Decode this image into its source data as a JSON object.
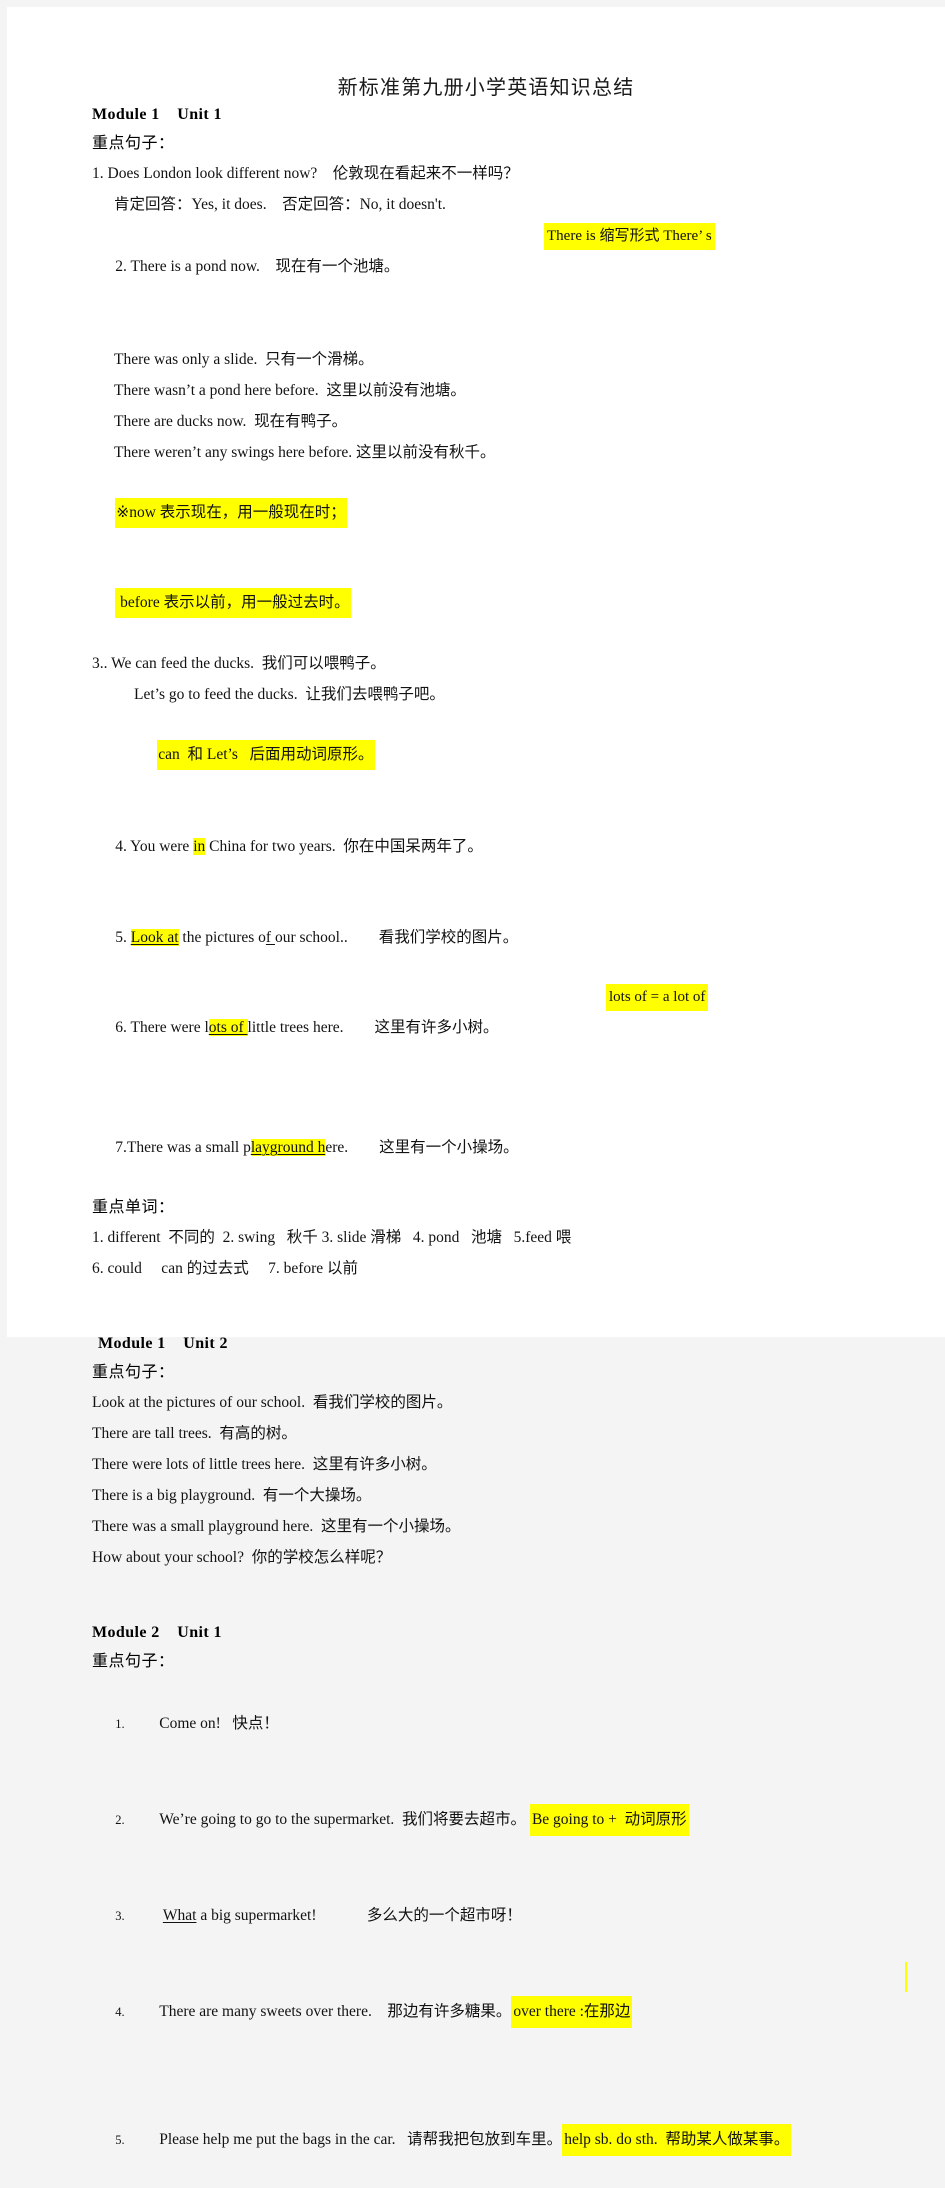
{
  "document": {
    "title": "新标准第九册小学英语知识总结",
    "background_color": "#f4f4f4",
    "page_color": "#ffffff",
    "highlight_color": "#ffff00"
  },
  "sections": [
    {
      "heading": "Module 1    Unit 1",
      "sub_label": "重点句子：",
      "lines": {
        "l1": "1. Does London look different now?    伦敦现在看起来不一样吗？",
        "l2": "肯定回答：Yes, it does.    否定回答：No, it doesn't.",
        "l3_main": "2. There is a pond now.    现在有一个池塘。",
        "l3_note": "There is 缩写形式 There’ s",
        "l4": "There was only a slide.  只有一个滑梯。",
        "l5": "There wasn’t a pond here before.  这里以前没有池塘。",
        "l6": "There are ducks now.  现在有鸭子。",
        "l7": "There weren’t any swings here before. 这里以前没有秋千。",
        "note_a": "※now 表示现在，用一般现在时；",
        "note_b": " before 表示以前，用一般过去时。",
        "l8": "3.. We can feed the ducks.  我们可以喂鸭子。",
        "l9": "Let’s go to feed the ducks.  让我们去喂鸭子吧。",
        "note_c": "can  和 Let’s   后面用动词原形。",
        "l10_a": "4. You were ",
        "l10_hl": "in",
        "l10_b": " China for two years.  你在中国呆两年了。",
        "l11_a": "5. ",
        "l11_hl": "Look at",
        "l11_b": " the pictures o",
        "l11_ul": "f ",
        "l11_c": "our school..        看我们学校的图片。",
        "l12_a": "6. There were l",
        "l12_hl": "ots of ",
        "l12_b": "little trees here.        这里有许多小树。",
        "l12_note": "lots of = a lot of",
        "l13_a": "7.There was a small p",
        "l13_hl": "layground h",
        "l13_b": "ere.        这里有一个小操场。"
      },
      "vocab_label": "重点单词：",
      "vocab_line_1": "1. different  不同的  2. swing   秋千 3. slide 滑梯   4. pond   池塘   5.feed 喂",
      "vocab_line_2": "6. could     can 的过去式     7. before 以前"
    },
    {
      "heading": "Module 1    Unit 2",
      "sub_label": "重点句子：",
      "lines": {
        "l1": "Look at the pictures of our school.  看我们学校的图片。",
        "l2": "There are tall trees.  有高的树。",
        "l3": "There were lots of little trees here.  这里有许多小树。",
        "l4": "There is a big playground.  有一个大操场。",
        "l5": "There was a small playground here.  这里有一个小操场。",
        "l6": "How about your school?  你的学校怎么样呢？"
      }
    },
    {
      "heading": "Module 2    Unit 1",
      "sub_label": "重点句子：",
      "items": [
        {
          "num": "1.",
          "text_a": "Come on!   快点！",
          "underline": "",
          "text_b": "",
          "note": ""
        },
        {
          "num": "2.",
          "text_a": "We’re going to go to the supermarket.  我们将要去超市。 ",
          "underline": "",
          "text_b": "",
          "note": "Be going to +  动词原形"
        },
        {
          "num": "3.",
          "text_a": " ",
          "underline": "What",
          "text_b": " a big supermarket!             多么大的一个超市呀！",
          "note": ""
        },
        {
          "num": "4.",
          "text_a": "There are many sweets over there.    那边有许多糖果。",
          "underline": "",
          "text_b": "",
          "note": "over there :在那边"
        },
        {
          "num": "5.",
          "text_a": "Please help me put the bags in the car.   请帮我把包放到车里。",
          "underline": "",
          "text_b": "",
          "note": "help sb. do sth.  帮助某人做某事。"
        }
      ]
    }
  ]
}
